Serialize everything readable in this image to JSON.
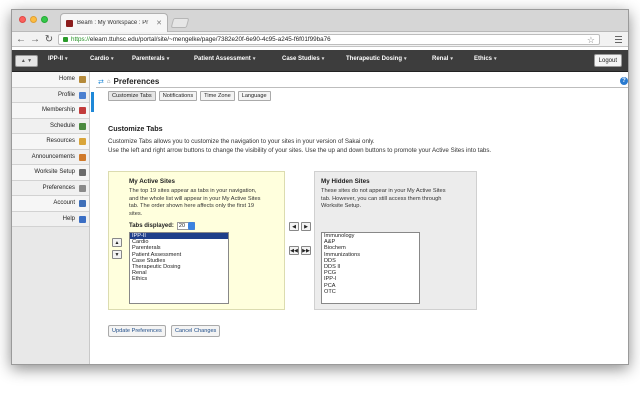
{
  "browser": {
    "tab_title": "Beam : My Workspace : Pr",
    "tab_close": "✕",
    "url_scheme": "https://",
    "url_rest": "elearn.ttuhsc.edu/portal/site/~mengelke/page/7382e20f-6e90-4c95-a245-f6f01f99ba76",
    "back_glyph": "←",
    "forward_glyph": "→",
    "reload_glyph": "↻",
    "star_glyph": "☆"
  },
  "sitenav": {
    "site_select": "▲ ▼",
    "tabs": [
      "IPP-II",
      "Cardio",
      "Parenterals",
      "Patient Assessment",
      "Case Studies",
      "Therapeutic Dosing",
      "Renal",
      "Ethics"
    ],
    "caret": "▾",
    "logout": "Logout"
  },
  "toolmenu": {
    "items": [
      {
        "label": "Home",
        "icon": "home-icon",
        "color": "#b48a3a"
      },
      {
        "label": "Profile",
        "icon": "plus-icon",
        "color": "#4a7fd0"
      },
      {
        "label": "Membership",
        "icon": "membership-icon",
        "color": "#c23b3b"
      },
      {
        "label": "Schedule",
        "icon": "calendar-icon",
        "color": "#4b8a3f"
      },
      {
        "label": "Resources",
        "icon": "folder-icon",
        "color": "#d9a53a"
      },
      {
        "label": "Announcements",
        "icon": "announcement-icon",
        "color": "#d07a2b"
      },
      {
        "label": "Worksite Setup",
        "icon": "setup-icon",
        "color": "#6b6b6b"
      },
      {
        "label": "Preferences",
        "icon": "gear-icon",
        "color": "#8a8a8a"
      },
      {
        "label": "Account",
        "icon": "user-icon",
        "color": "#3f6fb8"
      },
      {
        "label": "Help",
        "icon": "help-icon",
        "color": "#3a6ec4"
      }
    ]
  },
  "content": {
    "title": "Preferences",
    "help": "?",
    "subtabs": [
      "Customize Tabs",
      "Notifications",
      "Time Zone",
      "Language"
    ],
    "section_title": "Customize Tabs",
    "instructions": [
      "Customize Tabs allows you to customize the navigation to your sites in your version of Sakai only.",
      "Use the left and right arrow buttons to change the visibility of your sites. Use the up and down buttons to promote your Active Sites into tabs."
    ],
    "active": {
      "heading": "My Active Sites",
      "desc_lines": [
        "The top 19 sites appear as tabs in your navigation,",
        "and the whole list will appear in your My Active Sites",
        "tab. The order shown here affects only the first 19",
        "sites."
      ],
      "tabs_displayed_label": "Tabs displayed:",
      "tabs_displayed_value": "20",
      "sites": [
        "IPP-II",
        "Cardio",
        "Parenterals",
        "Patient Assessment",
        "Case Studies",
        "Therapeutic Dosing",
        "Renal",
        "Ethics"
      ]
    },
    "hidden": {
      "heading": "My Hidden Sites",
      "desc_lines": [
        "These sites do not appear in your My Active Sites",
        "tab. However, you can still access them through",
        "Worksite Setup."
      ],
      "sites": [
        "Immunology",
        "A&P",
        "Biochem",
        "Immunizations",
        "DDS",
        "DDS II",
        "PCG",
        "IPP-I",
        "PCA",
        "OTC"
      ]
    },
    "arrows": {
      "up": "▲",
      "down": "▼",
      "left": "◀",
      "right": "▶",
      "all_left": "◀◀",
      "all_right": "▶▶"
    },
    "buttons": {
      "update": "Update Preferences",
      "cancel": "Cancel Changes"
    }
  }
}
